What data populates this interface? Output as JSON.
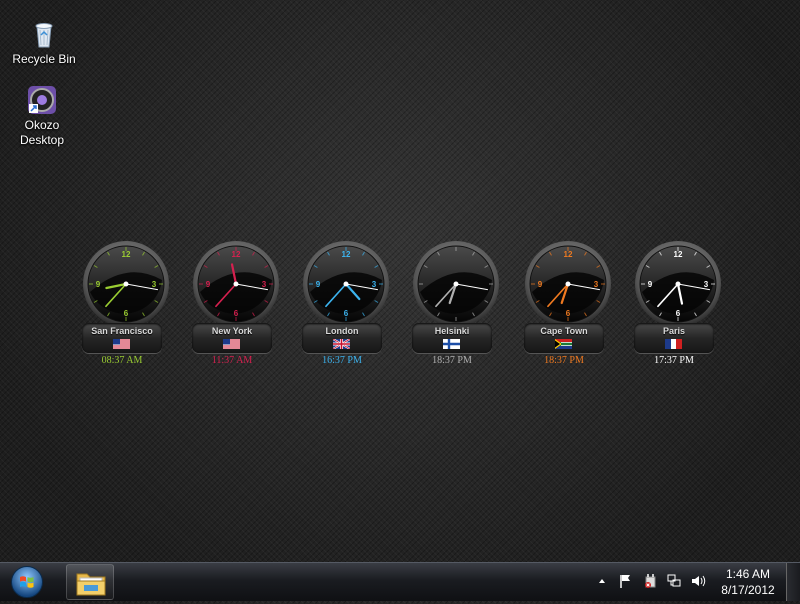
{
  "desktop_icons": [
    {
      "label": "Recycle Bin",
      "icon": "recycle-bin-icon"
    },
    {
      "label": "Okozo Desktop",
      "line1": "Okozo",
      "line2": "Desktop",
      "icon": "okozo-icon"
    }
  ],
  "clocks": [
    {
      "city": "San Francisco",
      "time": "08:37 AM",
      "accent": "#9acd32",
      "flag": "us",
      "numerals": [
        "12",
        "3",
        "6",
        "9"
      ]
    },
    {
      "city": "New York",
      "time": "11:37 AM",
      "accent": "#d6204f",
      "flag": "us",
      "numerals": [
        "12",
        "3",
        "6",
        "9"
      ]
    },
    {
      "city": "London",
      "time": "16:37 PM",
      "accent": "#3cb4f0",
      "flag": "uk",
      "numerals": [
        "12",
        "3",
        "6",
        "9"
      ]
    },
    {
      "city": "Helsinki",
      "time": "18:37 PM",
      "accent": "#b0b0b0",
      "flag": "fi",
      "numerals": []
    },
    {
      "city": "Cape Town",
      "time": "18:37 PM",
      "accent": "#f07a20",
      "flag": "za",
      "numerals": [
        "12",
        "3",
        "6",
        "9"
      ]
    },
    {
      "city": "Paris",
      "time": "17:37 PM",
      "accent": "#ffffff",
      "flag": "fr",
      "numerals": [
        "12",
        "3",
        "6",
        "9"
      ]
    }
  ],
  "taskbar": {
    "start_icon": "windows-start-icon",
    "pinned": [
      {
        "name": "windows-explorer",
        "icon": "folder-icon"
      }
    ],
    "tray_icons": [
      "show-hidden-icons-arrow-icon",
      "action-center-flag-icon",
      "power-icon",
      "network-icon",
      "volume-icon"
    ],
    "time": "1:46 AM",
    "date": "8/17/2012"
  }
}
